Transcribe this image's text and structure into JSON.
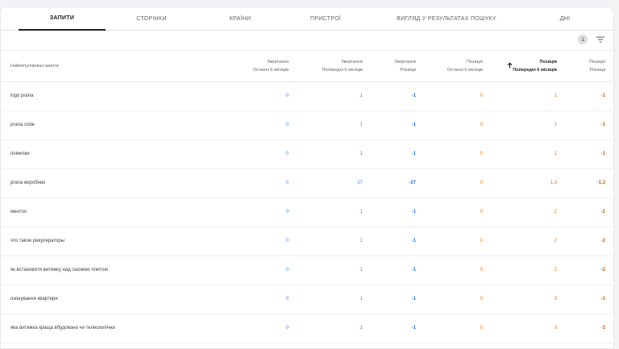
{
  "tabs": [
    {
      "label": "ЗАПИТИ",
      "active": true
    },
    {
      "label": "СТОРІНКИ",
      "active": false
    },
    {
      "label": "КРАЇНИ",
      "active": false
    },
    {
      "label": "ПРИСТРОЇ",
      "active": false
    },
    {
      "label": "ВИГЛЯД У РЕЗУЛЬТАТАХ ПОШУКУ",
      "active": false
    },
    {
      "label": "ДНІ",
      "active": false
    }
  ],
  "toolbar": {
    "filter_count": "1"
  },
  "columns": {
    "query": "Найпопулярніші запити",
    "clicks_last": {
      "l1": "Звертання",
      "l2": "Останні 6 місяців"
    },
    "clicks_prev": {
      "l1": "Звертання",
      "l2": "Попередні 6 місяців"
    },
    "clicks_diff": {
      "l1": "Звертання",
      "l2": "Різниця"
    },
    "pos_last": {
      "l1": "Позиція",
      "l2": "Останні 6 місяців"
    },
    "pos_prev": {
      "l1": "Позиція",
      "l2": "Попередні 6 місяців"
    },
    "pos_diff": {
      "l1": "Позиція",
      "l2": "Різниця"
    }
  },
  "rows": [
    {
      "query": "logo prana",
      "c_last": "0",
      "c_prev": "1",
      "c_diff": "-1",
      "p_last": "0",
      "p_prev": "1",
      "p_diff": "-1"
    },
    {
      "query": "prana code",
      "c_last": "0",
      "c_prev": "1",
      "c_diff": "-1",
      "p_last": "0",
      "p_prev": "1",
      "p_diff": "-1"
    },
    {
      "query": "помилки",
      "c_last": "0",
      "c_prev": "1",
      "c_diff": "-1",
      "p_last": "0",
      "p_prev": "1",
      "p_diff": "-1"
    },
    {
      "query": "prana виробник",
      "c_last": "0",
      "c_prev": "27",
      "c_diff": "-27",
      "p_last": "0",
      "p_prev": "1,3",
      "p_diff": "-1,3"
    },
    {
      "query": "ментол",
      "c_last": "0",
      "c_prev": "1",
      "c_diff": "-1",
      "p_last": "0",
      "p_prev": "2",
      "p_diff": "-2"
    },
    {
      "query": "что такое рекуператоры",
      "c_last": "0",
      "c_prev": "1",
      "c_diff": "-1",
      "p_last": "0",
      "p_prev": "2",
      "p_diff": "-2"
    },
    {
      "query": "як встановити витяжку над газовою плитою",
      "c_last": "0",
      "c_prev": "1",
      "c_diff": "-1",
      "p_last": "0",
      "p_prev": "2",
      "p_diff": "-2"
    },
    {
      "query": "озонування квартири",
      "c_last": "0",
      "c_prev": "1",
      "c_diff": "-1",
      "p_last": "0",
      "p_prev": "3",
      "p_diff": "-3"
    },
    {
      "query": "яка витяжка краща вбудована чи телескопічна",
      "c_last": "0",
      "c_prev": "1",
      "c_diff": "-1",
      "p_last": "0",
      "p_prev": "3",
      "p_diff": "-3"
    }
  ]
}
